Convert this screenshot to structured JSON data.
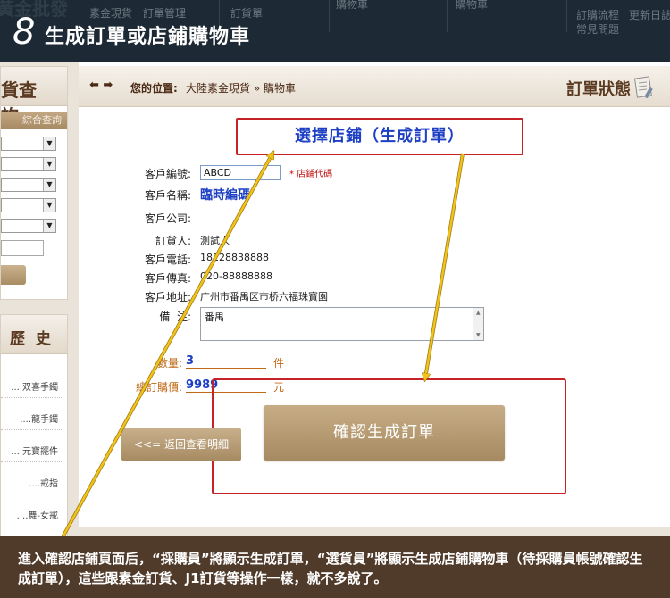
{
  "header": {
    "step_number": "8",
    "step_title": "生成訂單或店鋪購物車",
    "ghost_nav": [
      "素金現貨",
      "訂單管理",
      "訂貨單",
      "購物車",
      "購物車",
      "購物車",
      "訂購流程",
      "更新日誌",
      "常見問題"
    ]
  },
  "sidebar": {
    "query_title": "貨查詢",
    "advanced_tab": "綜合查詢",
    "history_title": "歷 史",
    "history_items": [
      "....双喜手鐲",
      "....龍手鐲",
      "....元寶擺件",
      "....戒指",
      "....舞-女戒"
    ]
  },
  "breadcrumb": {
    "label": "您的位置:",
    "path": "大陸素金現貨 » 購物車"
  },
  "status": {
    "title": "訂單狀態"
  },
  "store_select_title": "選擇店鋪（生成訂單）",
  "form": {
    "customer_code_label": "客戶編號:",
    "customer_code_value": "ABCD",
    "customer_code_hint": "* 店鋪代碼",
    "customer_name_label": "客戶名稱:",
    "customer_name_value": "臨時編碼",
    "customer_company_label": "客戶公司:",
    "orderer_label": "訂貨人:",
    "orderer_value": "測試人",
    "phone_label": "客戶電話:",
    "phone_value": "18128838888",
    "fax_label": "客戶傳真:",
    "fax_value": "020-88888888",
    "address_label": "客戶地址:",
    "address_value": "广州市番禺区市桥六福珠寶園",
    "remark_label": "備  注:",
    "remark_value": "番禺",
    "quantity_label": "數量:",
    "quantity_value": "3",
    "quantity_unit": "件",
    "price_label": "總訂購價:",
    "price_value": "9989",
    "price_unit": "元"
  },
  "buttons": {
    "back": "<<= 返回查看明細",
    "confirm": "確認生成訂單"
  },
  "caption": "進入確認店鋪頁面后，“採購員”將顯示生成訂單，“選貨員”將顯示生成店鋪購物車（待採購員帳號確認生成訂單），這些跟素金訂貨、J1訂貨等操作一樣，就不多說了。",
  "colors": {
    "header_bg": "#1d2a35",
    "caption_bg": "#503a2a",
    "accent_red": "#c62328",
    "link_blue": "#1c3fc4",
    "button_tan": "#b59a72",
    "arrow_yellow": "#f2c21b"
  }
}
